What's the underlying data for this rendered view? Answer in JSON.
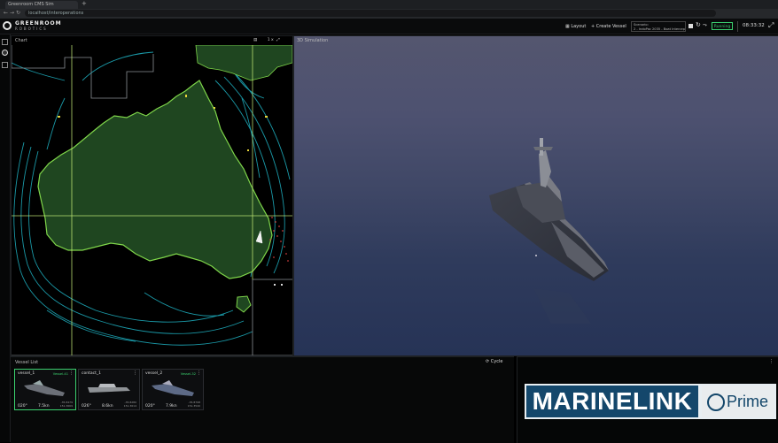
{
  "browser": {
    "tab_title": "Greenroom CMS Sim",
    "url": "localhost/interoperations"
  },
  "app": {
    "brand_line1": "GREENROOM",
    "brand_line2": "ROBOTICS",
    "layout_label": "Layout",
    "create_vessel_label": "Create Vessel",
    "scenario_label": "Scenario:",
    "scenario_value": "2 - IndoPac 2035 - Boat Intercept",
    "status": "Running",
    "clock": "08:33:32"
  },
  "chart_panel": {
    "title": "Chart",
    "scale": "1 x"
  },
  "sim_panel": {
    "title": "3D Simulation"
  },
  "vessel_list": {
    "title": "Vessel List",
    "cycle_label": "Cycle",
    "cards": [
      {
        "name": "vessel_1",
        "model": "Vessel-41",
        "heading": "020°",
        "speed": "7.5kn",
        "lat": "-35.8479",
        "lon": "151.3669",
        "selected": true
      },
      {
        "name": "contact_1",
        "model": "",
        "heading": "026°",
        "speed": "8.6kn",
        "lat": "-35.8280",
        "lon": "151.3614",
        "selected": false
      },
      {
        "name": "vessel_2",
        "model": "Vessel-32",
        "heading": "020°",
        "speed": "7.9kn",
        "lat": "-35.8798",
        "lon": "151.3540",
        "selected": false
      }
    ]
  },
  "watermark": {
    "left": "MARINELINK",
    "right": "Prime"
  },
  "colors": {
    "accent": "#3bd16f",
    "land": "#1f4620",
    "coast": "#7fd64a",
    "contour": "#1fb3c4",
    "sea": "#000000"
  },
  "icons": [
    "browser-back-icon",
    "browser-forward-icon",
    "reload-icon",
    "layout-grid-icon",
    "plus-icon",
    "stop-icon",
    "restart-icon",
    "step-icon",
    "expand-icon",
    "layers-icon",
    "gear-icon",
    "grid-icon",
    "kebab-icon",
    "cycle-icon",
    "compass-wheel-icon"
  ]
}
